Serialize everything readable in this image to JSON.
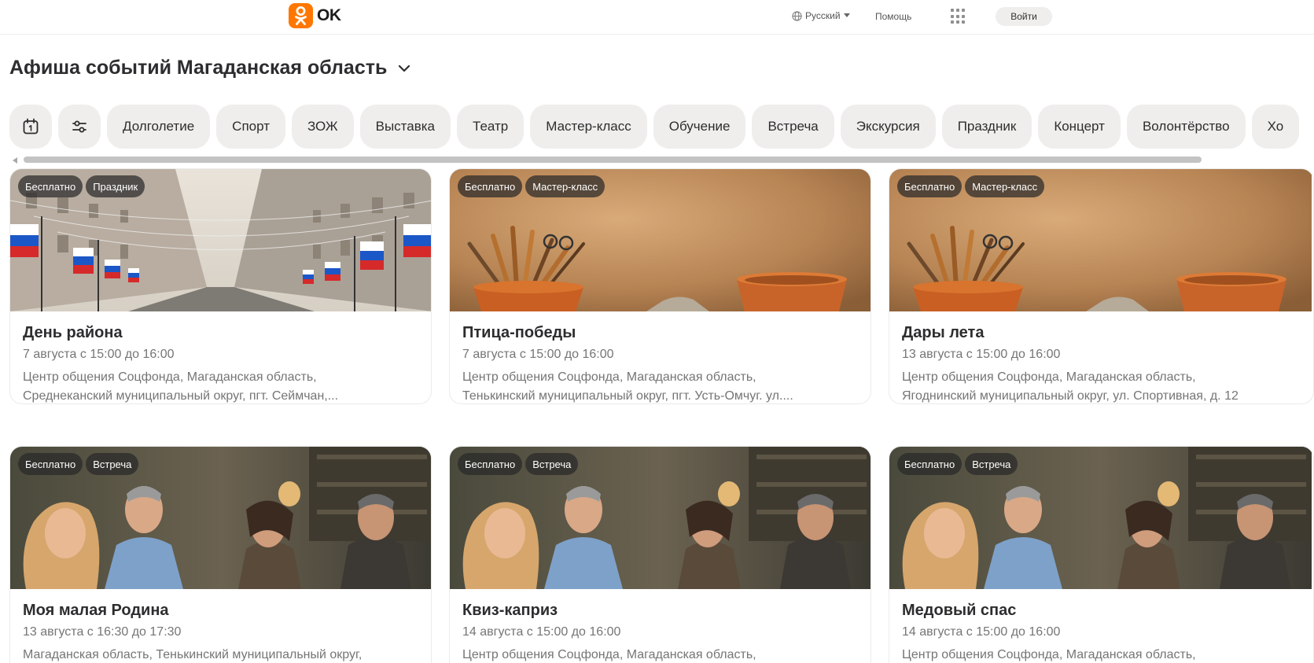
{
  "header": {
    "logo_text": "OK",
    "language": "Русский",
    "help": "Помощь",
    "login": "Войти"
  },
  "page": {
    "title": "Афиша событий Магаданская область"
  },
  "filters": [
    "Долголетие",
    "Спорт",
    "ЗОЖ",
    "Выставка",
    "Театр",
    "Мастер-класс",
    "Обучение",
    "Встреча",
    "Экскурсия",
    "Праздник",
    "Концерт",
    "Волонтёрство",
    "Хо"
  ],
  "cards": [
    {
      "tags": [
        "Бесплатно",
        "Праздник"
      ],
      "title": "День района",
      "date": "7 августа с 15:00 до 16:00",
      "addr1": "Центр общения Соцфонда, Магаданская область,",
      "addr2": "Среднеканский муниципальный округ, пгт. Сеймчан,..."
    },
    {
      "tags": [
        "Бесплатно",
        "Мастер-класс"
      ],
      "title": "Птица-победы",
      "date": "7 августа с 15:00 до 16:00",
      "addr1": "Центр общения Соцфонда, Магаданская область,",
      "addr2": "Тенькинский муниципальный округ, пгт. Усть-Омчуг. ул...."
    },
    {
      "tags": [
        "Бесплатно",
        "Мастер-класс"
      ],
      "title": "Дары лета",
      "date": "13 августа с 15:00 до 16:00",
      "addr1": "Центр общения Соцфонда, Магаданская область,",
      "addr2": "Ягоднинский муниципальный округ, ул. Спортивная, д. 12"
    },
    {
      "tags": [
        "Бесплатно",
        "Встреча"
      ],
      "title": "Моя малая Родина",
      "date": "13 августа с 16:30 до 17:30",
      "addr1": "Магаданская область, Тенькинский муниципальный округ,",
      "addr2": ""
    },
    {
      "tags": [
        "Бесплатно",
        "Встреча"
      ],
      "title": "Квиз-каприз",
      "date": "14 августа с 15:00 до 16:00",
      "addr1": "Центр общения Соцфонда, Магаданская область,",
      "addr2": ""
    },
    {
      "tags": [
        "Бесплатно",
        "Встреча"
      ],
      "title": "Медовый спас",
      "date": "14 августа с 15:00 до 16:00",
      "addr1": "Центр общения Соцфонда, Магаданская область,",
      "addr2": ""
    }
  ],
  "colors": {
    "brand": "#ff7700",
    "chip_bg": "#f0eeec",
    "text": "#2c2d2e",
    "muted": "#757575"
  }
}
